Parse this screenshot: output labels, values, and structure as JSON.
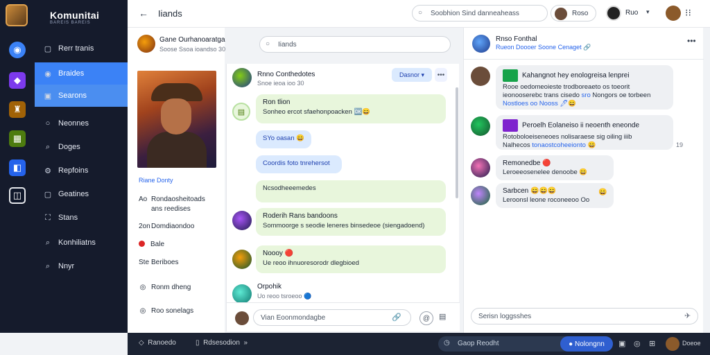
{
  "brand": {
    "title": "Komunitai",
    "subtitle": "BAREIS BAREIS"
  },
  "nav": {
    "items": [
      {
        "icon": "▢",
        "label": "Rerr tranis"
      },
      {
        "icon": "◉",
        "label": "Braides"
      },
      {
        "icon": "▣",
        "label": "Searons"
      },
      {
        "icon": "○",
        "label": "Neonnes"
      },
      {
        "icon": "⌕",
        "label": "Doges"
      },
      {
        "icon": "⚙",
        "label": "Repfoins"
      },
      {
        "icon": "▢",
        "label": "Geatines"
      },
      {
        "icon": "⛶",
        "label": "Stans"
      },
      {
        "icon": "⌕",
        "label": "Konhiliatns"
      },
      {
        "icon": "⌕",
        "label": "Nnyr"
      }
    ]
  },
  "topbar": {
    "back": "←",
    "title": "Iiands",
    "search_text": "Soobhion Sind danneaheass",
    "user_label": "Roso",
    "profile_name": "Ruo",
    "caret": "▾",
    "grid": "⁝⁝"
  },
  "group": {
    "name": "Gane Ourhanoaratga",
    "sub": "Soose Ssoa ioandso 30",
    "link": "Riane Donty",
    "rows": [
      {
        "icon": "Ao",
        "text": "Rondaosheitoads"
      },
      {
        "icon": "",
        "text": "ans reedises"
      },
      {
        "icon": "2on",
        "text": "Domdiaondoo"
      },
      {
        "icon": "dot",
        "text": "Bale"
      },
      {
        "icon": "Ste",
        "text": "Beriboes"
      },
      {
        "icon": "◎",
        "text": "Ronm dheng"
      },
      {
        "icon": "◎",
        "text": "Roo sonelags"
      }
    ]
  },
  "thread": {
    "header_name": "Rnno Conthedotes",
    "header_sub": "Snoe ieoa ioo 30",
    "pill": "Dasnor",
    "more": "•••",
    "green1_title": "Ron tlion",
    "green1_text": "Sonheo ercot sfaehonpoacken 🆗😄",
    "blue1": "SYo oasan 😄",
    "blue2": "Coordis foto tnrehersot",
    "green2": "Ncsodheeemedes",
    "msg3_name": "Roderih Rans bandoons",
    "msg3_text": "Sommoorge s seodie leneres binsedeoe (siengadoend)",
    "msg4_name": "Noooy 🔴",
    "msg4_text": "Ue reoo ihnuoresorodr dlegbioed",
    "msg5_name": "Orpohik",
    "msg5_sub": "Uo reoo tsroeoo 🔵",
    "composer_placeholder": "Vian Eoonmondagbe",
    "clip": "🔗",
    "at": "@",
    "emoji": "▤"
  },
  "chat": {
    "header_name": "Rnso Fonthal",
    "header_sub": "Rueon Doooer Soone Cenaget 🔗",
    "more": "•••",
    "m1_title": "Kahangnot hey enologreisa lenprei",
    "m1_l1": "Rooe oedomeoieste trodboreaeto os toeorit",
    "m1_l2_a": "ieonooserebc trans cisedo",
    "m1_l2_link": "sro",
    "m1_l2_b": "Nongors oe torbeen",
    "m1_l3": "Nostloes oo Nooss 🖊😄",
    "m2_title": "Peroelh Eolaneiso ii neoenth eneonde",
    "m2_l1": "Rotoboloeiseneoes nolisaraese sig oiling iiib",
    "m2_l2_a": "Nalhecos",
    "m2_l2_link": "tonaostcoheeionto",
    "m2_l2_b": "😄",
    "m2_time": "19",
    "m3_name": "Remonedbe 🔴",
    "m3_text": "Leroeeosenelee denoobe 😄",
    "m4_name": "Sarbcen 😄😄😄",
    "m4_text": "Leroonsl leone roconeeoo Oo",
    "input_placeholder": "Serisn loggsshes",
    "send": "✈"
  },
  "bottombar": {
    "left1": "Ranoedo",
    "left2": "Rdsesodion",
    "left2_extra": "»",
    "status_text": "Gaop Reodht",
    "live_label": "Nolongnn",
    "user": "Doeoe"
  },
  "colors": {
    "accent": "#3b82f6",
    "nav_bg": "#151b2c",
    "bubble_green": "#e8f6dc",
    "bubble_blue": "#dbeafe"
  }
}
